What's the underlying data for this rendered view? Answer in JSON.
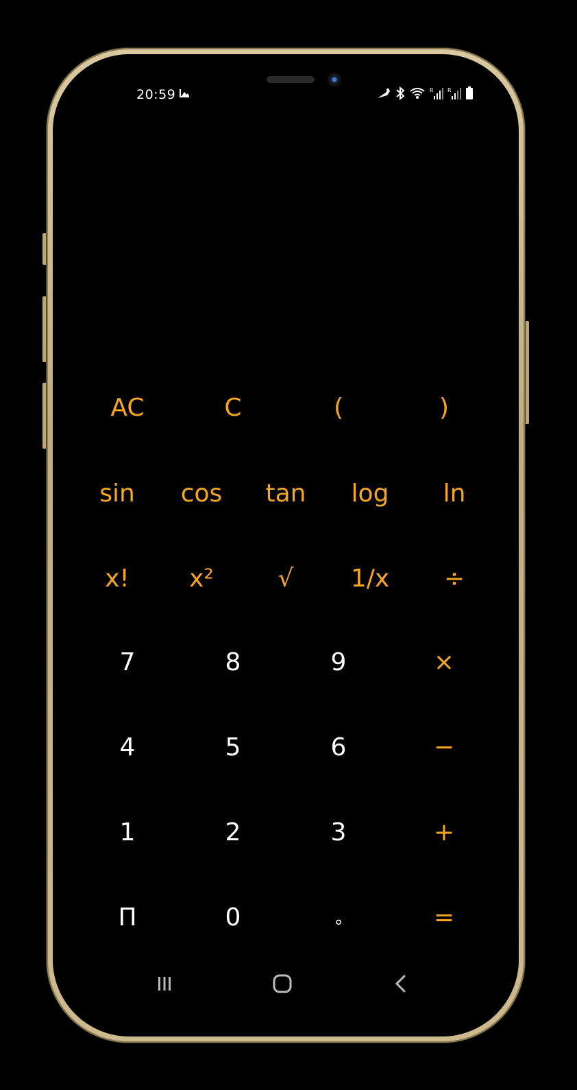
{
  "status_bar": {
    "time": "20:59"
  },
  "theme": {
    "accent": "#f5a623",
    "digit": "#ffffff",
    "background": "#000000",
    "frame": "#cdbb8f"
  },
  "keys": {
    "row1": [
      "AC",
      "C",
      "(",
      ")"
    ],
    "row2": [
      "sin",
      "cos",
      "tan",
      "log",
      "ln"
    ],
    "row3": [
      "x!",
      "x²",
      "√",
      "1/x",
      "÷"
    ],
    "row4": [
      "7",
      "8",
      "9",
      "×"
    ],
    "row5": [
      "4",
      "5",
      "6",
      "−"
    ],
    "row6": [
      "1",
      "2",
      "3",
      "+"
    ],
    "row7": [
      "Π",
      "0",
      "∘",
      "="
    ]
  },
  "nav_bar": {
    "recents_icon": "recent-apps-icon",
    "home_icon": "home-icon",
    "back_icon": "back-icon"
  }
}
